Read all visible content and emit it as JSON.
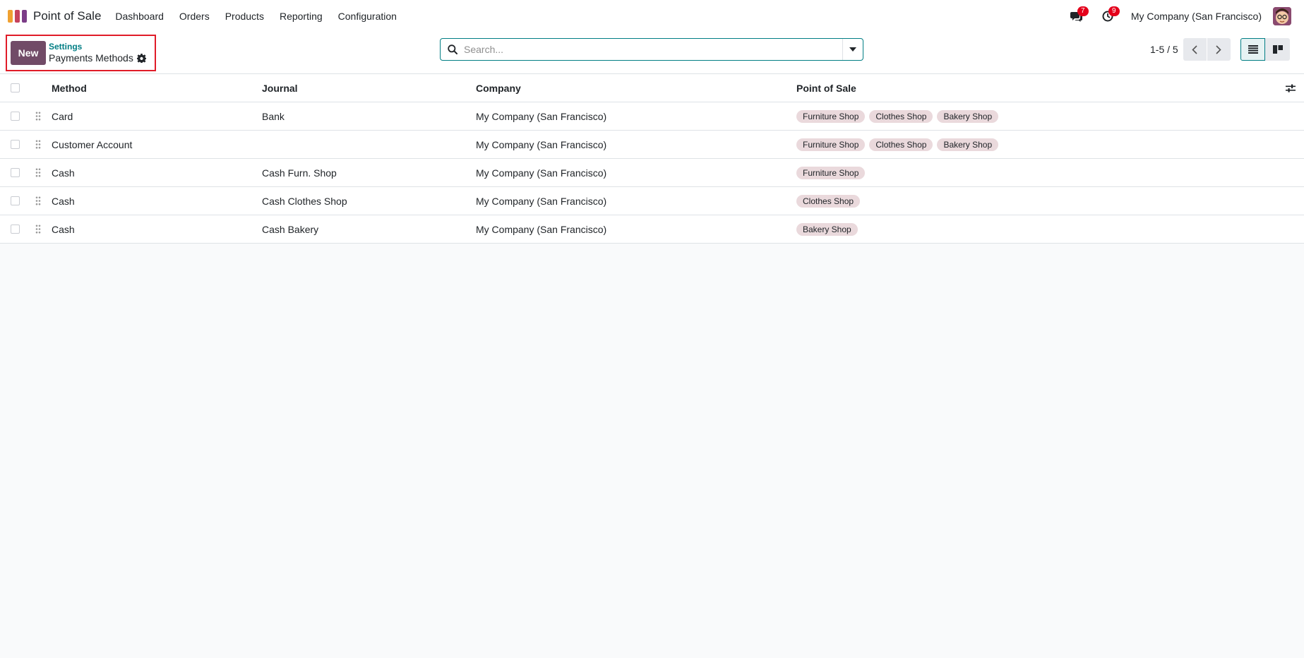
{
  "navbar": {
    "app_title": "Point of Sale",
    "menu": [
      "Dashboard",
      "Orders",
      "Products",
      "Reporting",
      "Configuration"
    ],
    "messages_count": "7",
    "activities_count": "9",
    "company": "My Company (San Francisco)",
    "logo_colors": [
      "#f0a131",
      "#c6435d",
      "#7b3c87"
    ]
  },
  "control_panel": {
    "new_label": "New",
    "breadcrumb_parent": "Settings",
    "breadcrumb_current": "Payments Methods",
    "search_placeholder": "Search...",
    "pager": "1-5 / 5"
  },
  "table": {
    "columns": {
      "method": "Method",
      "journal": "Journal",
      "company": "Company",
      "pos": "Point of Sale"
    },
    "rows": [
      {
        "method": "Card",
        "journal": "Bank",
        "company": "My Company (San Francisco)",
        "pos": [
          "Furniture Shop",
          "Clothes Shop",
          "Bakery Shop"
        ]
      },
      {
        "method": "Customer Account",
        "journal": "",
        "company": "My Company (San Francisco)",
        "pos": [
          "Furniture Shop",
          "Clothes Shop",
          "Bakery Shop"
        ]
      },
      {
        "method": "Cash",
        "journal": "Cash Furn. Shop",
        "company": "My Company (San Francisco)",
        "pos": [
          "Furniture Shop"
        ]
      },
      {
        "method": "Cash",
        "journal": "Cash Clothes Shop",
        "company": "My Company (San Francisco)",
        "pos": [
          "Clothes Shop"
        ]
      },
      {
        "method": "Cash",
        "journal": "Cash Bakery",
        "company": "My Company (San Francisco)",
        "pos": [
          "Bakery Shop"
        ]
      }
    ]
  },
  "colors": {
    "primary": "#714b67",
    "accent": "#017e84",
    "badge": "#e4001b",
    "tag_bg": "#ead9dc",
    "highlight_border": "#e01c28"
  }
}
